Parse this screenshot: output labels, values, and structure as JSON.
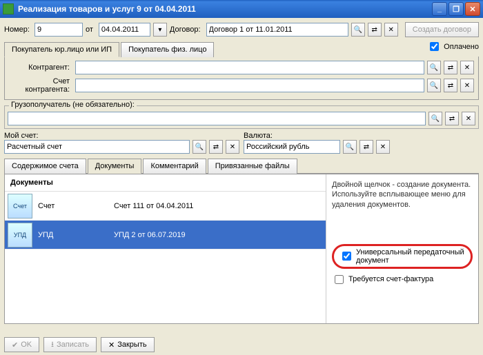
{
  "window": {
    "title": "Реализация товаров и услуг 9 от 04.04.2011"
  },
  "header": {
    "number_label": "Номер:",
    "number": "9",
    "from_label": "от",
    "date": "04.04.2011",
    "contract_label": "Договор:",
    "contract": "Договор 1 от 11.01.2011",
    "create_contract": "Создать договор",
    "paid_label": "Оплачено"
  },
  "tabs_buyer": {
    "legal": "Покупатель юр.лицо или ИП",
    "person": "Покупатель физ. лицо"
  },
  "buyer": {
    "counterparty_label": "Контрагент:",
    "counterparty": "",
    "account_label": "Счет контрагента:",
    "account": ""
  },
  "consignee_label": "Грузополучатель (не обязательно):",
  "consignee": "",
  "myaccount_label": "Мой счет:",
  "myaccount": "Расчетный счет",
  "currency_label": "Валюта:",
  "currency": "Российский рубль",
  "tabs_main": {
    "content": "Содержимое счета",
    "docs": "Документы",
    "comment": "Комментарий",
    "files": "Привязанные файлы"
  },
  "docs": {
    "header": "Документы",
    "rows": [
      {
        "icon": "Счет",
        "name": "Счет",
        "info": "Счет 111 от 04.04.2011"
      },
      {
        "icon": "УПД",
        "name": "УПД",
        "info": "УПД 2 от 06.07.2019"
      }
    ],
    "hint": "Двойной щелчок - создание документа. Используйте всплывающее меню для удаления документов.",
    "upd_label": "Универсальный передаточный документ",
    "invoice_label": "Требуется счет-фактура"
  },
  "footer": {
    "ok": "OK",
    "save": "Записать",
    "close": "Закрыть"
  },
  "glyph": {
    "search": "🔍",
    "arrows": "⇄",
    "x": "✕",
    "cal": "▾",
    "min": "_",
    "max": "❐",
    "close": "✕",
    "check": "✔",
    "save": "⭳"
  }
}
